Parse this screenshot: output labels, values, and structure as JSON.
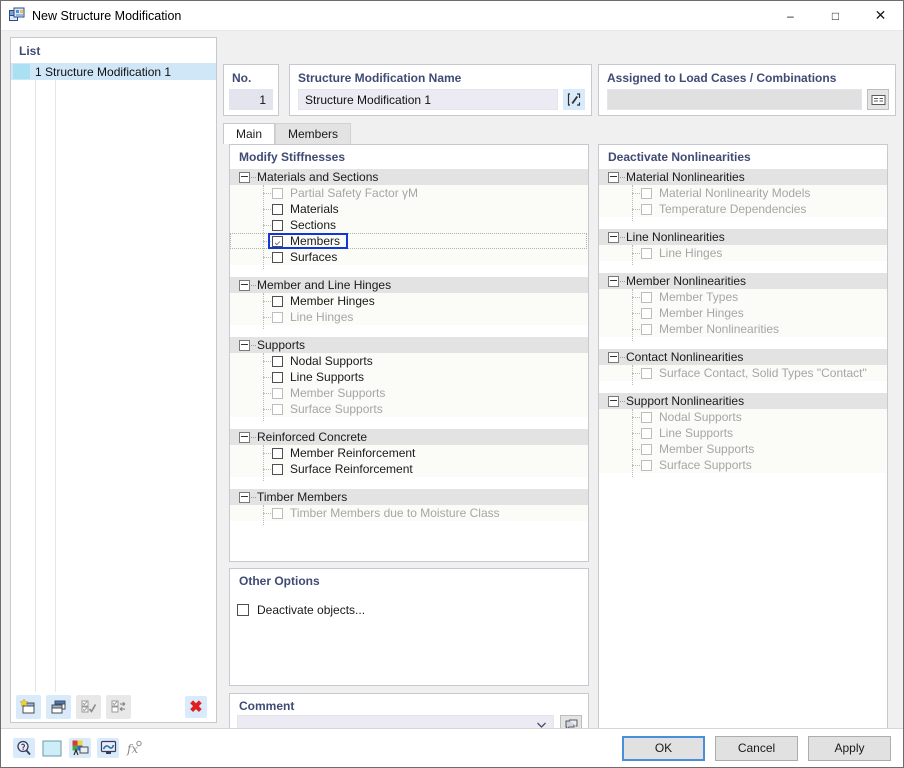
{
  "window": {
    "title": "New Structure Modification",
    "icon": "structure-modification-icon",
    "minimize": "–",
    "maximize": "□",
    "close": "✕"
  },
  "list_panel": {
    "header": "List",
    "rows": [
      {
        "label": "1 Structure Modification 1",
        "selected": true
      }
    ],
    "toolbar": [
      {
        "name": "new-button",
        "enabled": true
      },
      {
        "name": "copy-button",
        "enabled": true
      },
      {
        "name": "check-all-button",
        "enabled": false
      },
      {
        "name": "toggle-check-button",
        "enabled": false
      },
      {
        "name": "delete-button",
        "enabled": true,
        "glyph": "✖"
      }
    ]
  },
  "header": {
    "no_label": "No.",
    "no_value": "1",
    "name_label": "Structure Modification Name",
    "name_value": "Structure Modification 1",
    "name_placeholder": "",
    "edit_icon": "edit-name-icon",
    "assigned_label": "Assigned to Load Cases / Combinations",
    "assigned_value": "",
    "assigned_placeholder": "",
    "assigned_icon": "select-load-cases-icon"
  },
  "tabs": [
    {
      "label": "Main",
      "active": true
    },
    {
      "label": "Members",
      "active": false
    }
  ],
  "modify_stiffnesses": {
    "title": "Modify Stiffnesses",
    "groups": [
      {
        "label": "Materials and Sections",
        "items": [
          {
            "label": "Partial Safety Factor γM",
            "checked": false,
            "enabled": false,
            "focused": false
          },
          {
            "label": "Materials",
            "checked": false,
            "enabled": true,
            "focused": false
          },
          {
            "label": "Sections",
            "checked": false,
            "enabled": true,
            "focused": false
          },
          {
            "label": "Members",
            "checked": true,
            "enabled": true,
            "focused": true
          },
          {
            "label": "Surfaces",
            "checked": false,
            "enabled": true,
            "focused": false
          }
        ]
      },
      {
        "label": "Member and Line Hinges",
        "items": [
          {
            "label": "Member Hinges",
            "checked": false,
            "enabled": true,
            "focused": false
          },
          {
            "label": "Line Hinges",
            "checked": false,
            "enabled": false,
            "focused": false
          }
        ]
      },
      {
        "label": "Supports",
        "items": [
          {
            "label": "Nodal Supports",
            "checked": false,
            "enabled": true,
            "focused": false
          },
          {
            "label": "Line Supports",
            "checked": false,
            "enabled": true,
            "focused": false
          },
          {
            "label": "Member Supports",
            "checked": false,
            "enabled": false,
            "focused": false
          },
          {
            "label": "Surface Supports",
            "checked": false,
            "enabled": false,
            "focused": false
          }
        ]
      },
      {
        "label": "Reinforced Concrete",
        "items": [
          {
            "label": "Member Reinforcement",
            "checked": false,
            "enabled": true,
            "focused": false
          },
          {
            "label": "Surface Reinforcement",
            "checked": false,
            "enabled": true,
            "focused": false
          }
        ]
      },
      {
        "label": "Timber Members",
        "items": [
          {
            "label": "Timber Members due to Moisture Class",
            "checked": false,
            "enabled": false,
            "focused": false
          }
        ]
      }
    ]
  },
  "deactivate_nonlinearities": {
    "title": "Deactivate Nonlinearities",
    "groups": [
      {
        "label": "Material Nonlinearities",
        "items": [
          {
            "label": "Material Nonlinearity Models",
            "checked": false,
            "enabled": false,
            "focused": false
          },
          {
            "label": "Temperature Dependencies",
            "checked": false,
            "enabled": false,
            "focused": false
          }
        ]
      },
      {
        "label": "Line Nonlinearities",
        "items": [
          {
            "label": "Line Hinges",
            "checked": false,
            "enabled": false,
            "focused": false
          }
        ]
      },
      {
        "label": "Member Nonlinearities",
        "items": [
          {
            "label": "Member Types",
            "checked": false,
            "enabled": false,
            "focused": false
          },
          {
            "label": "Member Hinges",
            "checked": false,
            "enabled": false,
            "focused": false
          },
          {
            "label": "Member Nonlinearities",
            "checked": false,
            "enabled": false,
            "focused": false
          }
        ]
      },
      {
        "label": "Contact Nonlinearities",
        "items": [
          {
            "label": "Surface Contact, Solid Types \"Contact\"",
            "checked": false,
            "enabled": false,
            "focused": false
          }
        ]
      },
      {
        "label": "Support Nonlinearities",
        "items": [
          {
            "label": "Nodal Supports",
            "checked": false,
            "enabled": false,
            "focused": false
          },
          {
            "label": "Line Supports",
            "checked": false,
            "enabled": false,
            "focused": false
          },
          {
            "label": "Member Supports",
            "checked": false,
            "enabled": false,
            "focused": false
          },
          {
            "label": "Surface Supports",
            "checked": false,
            "enabled": false,
            "focused": false
          }
        ]
      }
    ]
  },
  "other_options": {
    "title": "Other Options",
    "deactivate_objects_label": "Deactivate objects...",
    "deactivate_objects_checked": false
  },
  "comment": {
    "title": "Comment",
    "value": "",
    "placeholder": "",
    "dropdown_icon": "chevron-down-icon",
    "picker_icon": "comment-library-icon"
  },
  "bottom_bar": {
    "icons": [
      {
        "name": "help-icon",
        "enabled": true
      },
      {
        "name": "color-swatch-icon",
        "enabled": true
      },
      {
        "name": "render-settings-icon",
        "enabled": true
      },
      {
        "name": "display-properties-icon",
        "enabled": true
      },
      {
        "name": "formula-icon",
        "enabled": false
      }
    ],
    "buttons": [
      {
        "name": "ok-button",
        "label": "OK",
        "default": true
      },
      {
        "name": "cancel-button",
        "label": "Cancel",
        "default": false
      },
      {
        "name": "apply-button",
        "label": "Apply",
        "default": false
      }
    ]
  },
  "colors": {
    "header_text": "#3f4b74",
    "selection": "#cfe7f7",
    "focus_border": "#1137d8",
    "group_header_bg": "#e3e3e3",
    "item_bg": "#fbfbf8",
    "delete_red": "#e02020",
    "default_button_border": "#4a90d9"
  }
}
